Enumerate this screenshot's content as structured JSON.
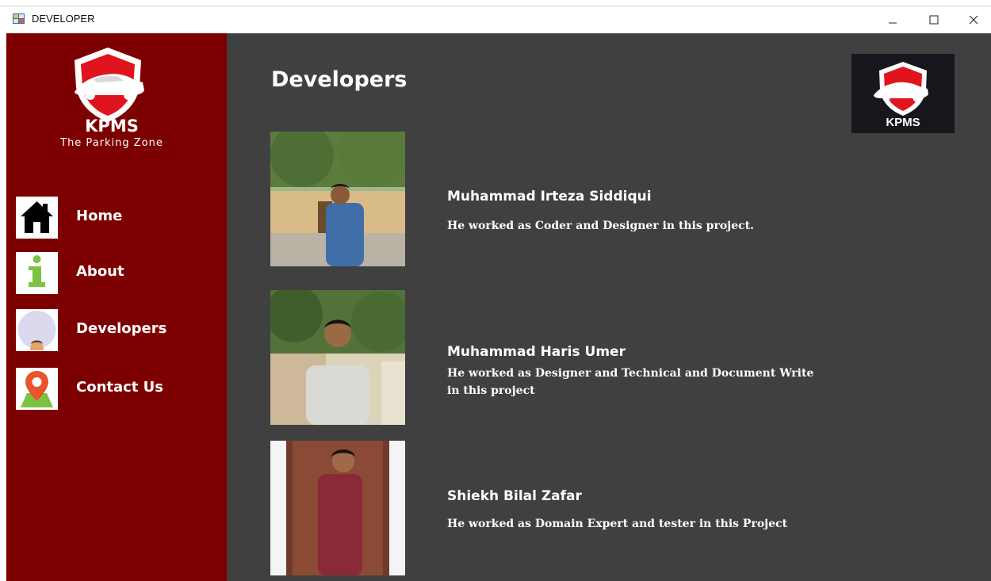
{
  "window": {
    "title": "DEVELOPER",
    "controls": {
      "minimize_icon": "minimize-icon",
      "maximize_icon": "maximize-icon",
      "close_icon": "close-icon"
    }
  },
  "sidebar": {
    "brand": {
      "name": "KPMS",
      "tagline": "The Parking Zone"
    },
    "items": [
      {
        "label": "Home",
        "icon": "home-icon"
      },
      {
        "label": "About",
        "icon": "info-icon"
      },
      {
        "label": "Developers",
        "icon": "developer-avatar-icon"
      },
      {
        "label": "Contact Us",
        "icon": "location-pin-icon"
      }
    ]
  },
  "main": {
    "title": "Developers",
    "corner_logo_text": "KPMS",
    "developers": [
      {
        "name": "Muhammad Irteza Siddiqui",
        "description": "He worked as Coder and Designer in this project."
      },
      {
        "name": "Muhammad Haris Umer",
        "description": "He worked as Designer and Technical and Document Write in this project"
      },
      {
        "name": "Shiekh Bilal Zafar",
        "description": "He worked as Domain Expert and tester in this Project"
      }
    ]
  },
  "colors": {
    "sidebar_bg": "#7d0000",
    "main_bg": "#404040",
    "logo_red": "#e0141e"
  }
}
